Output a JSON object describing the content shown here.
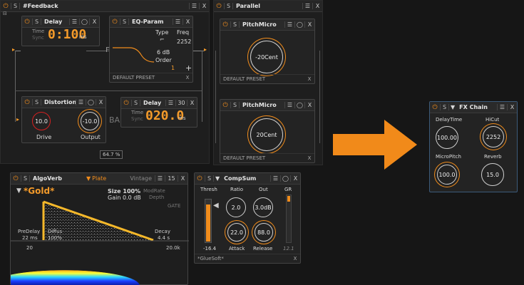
{
  "colors": {
    "accent": "#f08c1c",
    "background": "#161616",
    "panel": "#232323",
    "spectrum_blue": "#1b3cff"
  },
  "icons": {
    "power": "power-icon",
    "menu": "menu-icon",
    "preset": "preset-icon",
    "close": "close-icon"
  },
  "feedback": {
    "title": "#Feedback",
    "mix_value": "64.7 %",
    "delay": {
      "title": "Delay",
      "time_label": "Time",
      "sync_label": "Sync",
      "value": "0:100",
      "unit": "ms"
    },
    "eq": {
      "title": "EQ-Param",
      "type_label": "Type",
      "freq_label": "Freq",
      "freq_value": "2252",
      "gain_value": "6 dB",
      "order_label": "Order",
      "order_value": "1",
      "preset": "DEFAULT PRESET",
      "letter": "F"
    },
    "distortion": {
      "title": "Distortion",
      "drive_label": "Drive",
      "drive_value": "10.0",
      "output_label": "Output",
      "output_value": "-10.0"
    },
    "delay2": {
      "title": "Delay",
      "time_label": "Time",
      "sync_label": "Sync",
      "value": "020.0",
      "unit": "ms",
      "header_value": "30",
      "side_text": "BA"
    }
  },
  "parallel": {
    "title": "Parallel",
    "pitch1": {
      "title": "PitchMicro",
      "value": "-20Cent",
      "preset": "DEFAULT PRESET"
    },
    "pitch2": {
      "title": "PitchMicro",
      "value": "20Cent",
      "preset": "DEFAULT PRESET"
    }
  },
  "algoverb": {
    "title": "AlgoVerb",
    "preset_name": "Plate",
    "vintage_label": "Vintage",
    "header_value": "15",
    "patch_name": "*Gold*",
    "size_label": "Size 100%",
    "gain_label": "Gain 0.0 dB",
    "modrate_label": "ModRate",
    "depth_label": "Depth",
    "gate_label": "GATE",
    "predelay_label": "PreDelay",
    "predelay_value": "22 ms",
    "diffus_label": "Diffus",
    "diffus_value": "100%",
    "decay_label": "Decay",
    "decay_value": "4.4 s",
    "low_cut": "20",
    "high_cut": "20.0k"
  },
  "compsum": {
    "title": "CompSum",
    "thresh_label": "Thresh",
    "ratio_label": "Ratio",
    "out_label": "Out",
    "gr_label": "GR",
    "ratio_value": "2.0",
    "out_value": "3.0dB",
    "attack_label": "Attack",
    "attack_value": "22.0",
    "release_label": "Release",
    "release_value": "88.0",
    "thresh_value": "-16.4",
    "gr_value": "12.1",
    "preset": "*GlueSoft*"
  },
  "fxchain": {
    "title": "FX Chain",
    "knobs": [
      {
        "label": "DelayTime",
        "value": "100.00"
      },
      {
        "label": "HiCut",
        "value": "2252"
      },
      {
        "label": "MicroPitch",
        "value": "100.0"
      },
      {
        "label": "Reverb",
        "value": "15.0"
      }
    ]
  }
}
